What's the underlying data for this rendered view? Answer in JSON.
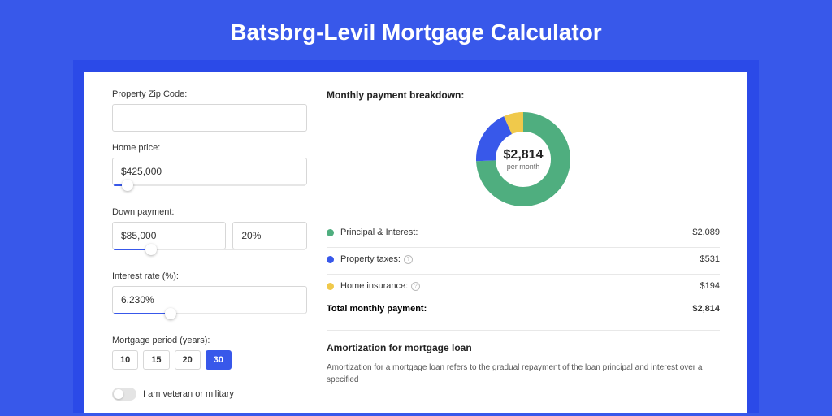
{
  "title": "Batsbrg-Levil Mortgage Calculator",
  "form": {
    "zip_label": "Property Zip Code:",
    "zip_value": "",
    "price_label": "Home price:",
    "price_value": "$425,000",
    "price_slider_pct": 8,
    "down_label": "Down payment:",
    "down_value": "$85,000",
    "down_pct_value": "20%",
    "down_slider_pct": 20,
    "rate_label": "Interest rate (%):",
    "rate_value": "6.230%",
    "rate_slider_pct": 30,
    "period_label": "Mortgage period (years):",
    "periods": [
      "10",
      "15",
      "20",
      "30"
    ],
    "period_active_index": 3,
    "veteran_label": "I am veteran or military",
    "veteran_on": false
  },
  "breakdown": {
    "title": "Monthly payment breakdown:",
    "donut_amount": "$2,814",
    "donut_sub": "per month",
    "items": [
      {
        "label": "Principal & Interest:",
        "value": "$2,089",
        "color": "green",
        "info": false
      },
      {
        "label": "Property taxes:",
        "value": "$531",
        "color": "blue",
        "info": true
      },
      {
        "label": "Home insurance:",
        "value": "$194",
        "color": "yellow",
        "info": true
      }
    ],
    "total_label": "Total monthly payment:",
    "total_value": "$2,814"
  },
  "amort": {
    "title": "Amortization for mortgage loan",
    "text": "Amortization for a mortgage loan refers to the gradual repayment of the loan principal and interest over a specified"
  },
  "chart_data": {
    "type": "pie",
    "title": "Monthly payment breakdown",
    "categories": [
      "Principal & Interest",
      "Property taxes",
      "Home insurance"
    ],
    "values": [
      2089,
      531,
      194
    ],
    "colors": [
      "#4fae7f",
      "#3858ea",
      "#f0c94b"
    ],
    "total": 2814
  }
}
